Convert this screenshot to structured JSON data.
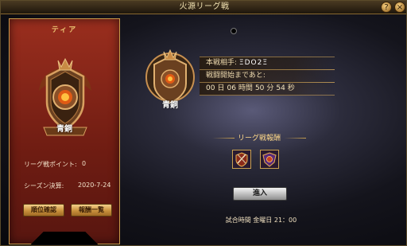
{
  "window": {
    "title": "火源リーグ戦",
    "help_label": "?",
    "close_label": "×"
  },
  "left_panel": {
    "header": "ティア",
    "rank_name": "青銅",
    "points_label": "リーグ戦ポイント:",
    "points_value": "0",
    "season_label": "シーズン決算:",
    "season_value": "2020-7-24",
    "rank_check_label": "順位確認",
    "rewards_list_label": "報酬一覧"
  },
  "match": {
    "rank_name": "青銅",
    "opponent_label": "本戦相手:",
    "opponent_value": "ΞDΟ2Ξ",
    "countdown_label": "戦闘開始まであと:",
    "countdown": {
      "days": "00",
      "days_unit": "日",
      "hours": "06",
      "hours_unit": "時間",
      "minutes": "50",
      "minutes_unit": "分",
      "seconds": "54",
      "seconds_unit": "秒"
    },
    "rewards_title": "リーグ戦報酬",
    "enter_label": "進入",
    "match_time": "試合時間 金曜日 21：00"
  },
  "colors": {
    "panel_red": "#8a2418",
    "gold_trim": "#c89a4a",
    "bronze": "#b87a3a"
  }
}
